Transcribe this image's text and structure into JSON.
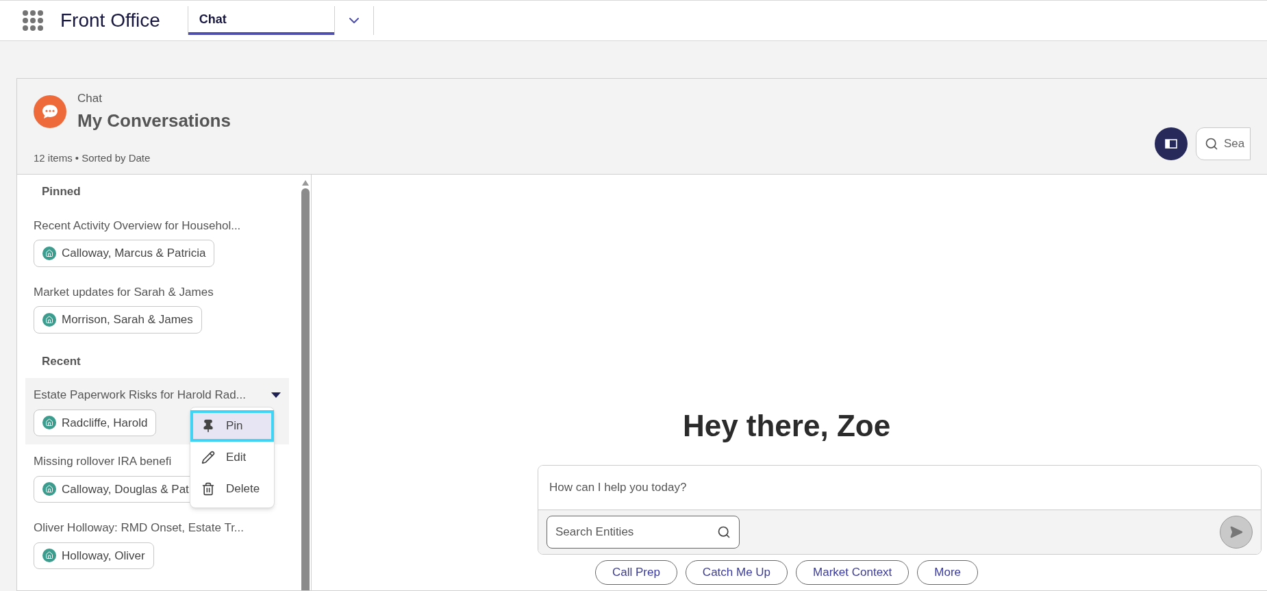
{
  "app": {
    "name": "Front Office"
  },
  "tabs": [
    {
      "label": "Chat",
      "selected": true
    }
  ],
  "header": {
    "object": "Chat",
    "title": "My Conversations",
    "meta": "12 items • Sorted by Date",
    "search": {
      "placeholder": "Sea"
    }
  },
  "sections": [
    {
      "heading": "Pinned",
      "items": [
        {
          "title": "Recent Activity Overview for Househol...",
          "entity": "Calloway, Marcus & Patricia",
          "selected": false
        },
        {
          "title": "Market updates for Sarah & James",
          "entity": "Morrison, Sarah & James",
          "selected": false
        }
      ]
    },
    {
      "heading": "Recent",
      "items": [
        {
          "title": "Estate Paperwork Risks for Harold Rad...",
          "entity": "Radcliffe, Harold",
          "selected": true
        },
        {
          "title": "Missing rollover IRA benefi",
          "entity": "Calloway, Douglas & Pat",
          "selected": false
        },
        {
          "title": "Oliver Holloway: RMD Onset, Estate Tr...",
          "entity": "Holloway, Oliver",
          "selected": false
        }
      ]
    }
  ],
  "menu": [
    {
      "kind": "pin",
      "label": "Pin",
      "selected": true
    },
    {
      "kind": "edit",
      "label": "Edit",
      "selected": false
    },
    {
      "kind": "delete",
      "label": "Delete",
      "selected": false
    }
  ],
  "greeting": "Hey there, Zoe",
  "composer": {
    "placeholder": "How can I help you today?",
    "entity_search": {
      "placeholder": "Search Entities"
    }
  },
  "suggestions": [
    "Call Prep",
    "Catch Me Up",
    "Market Context",
    "More"
  ]
}
